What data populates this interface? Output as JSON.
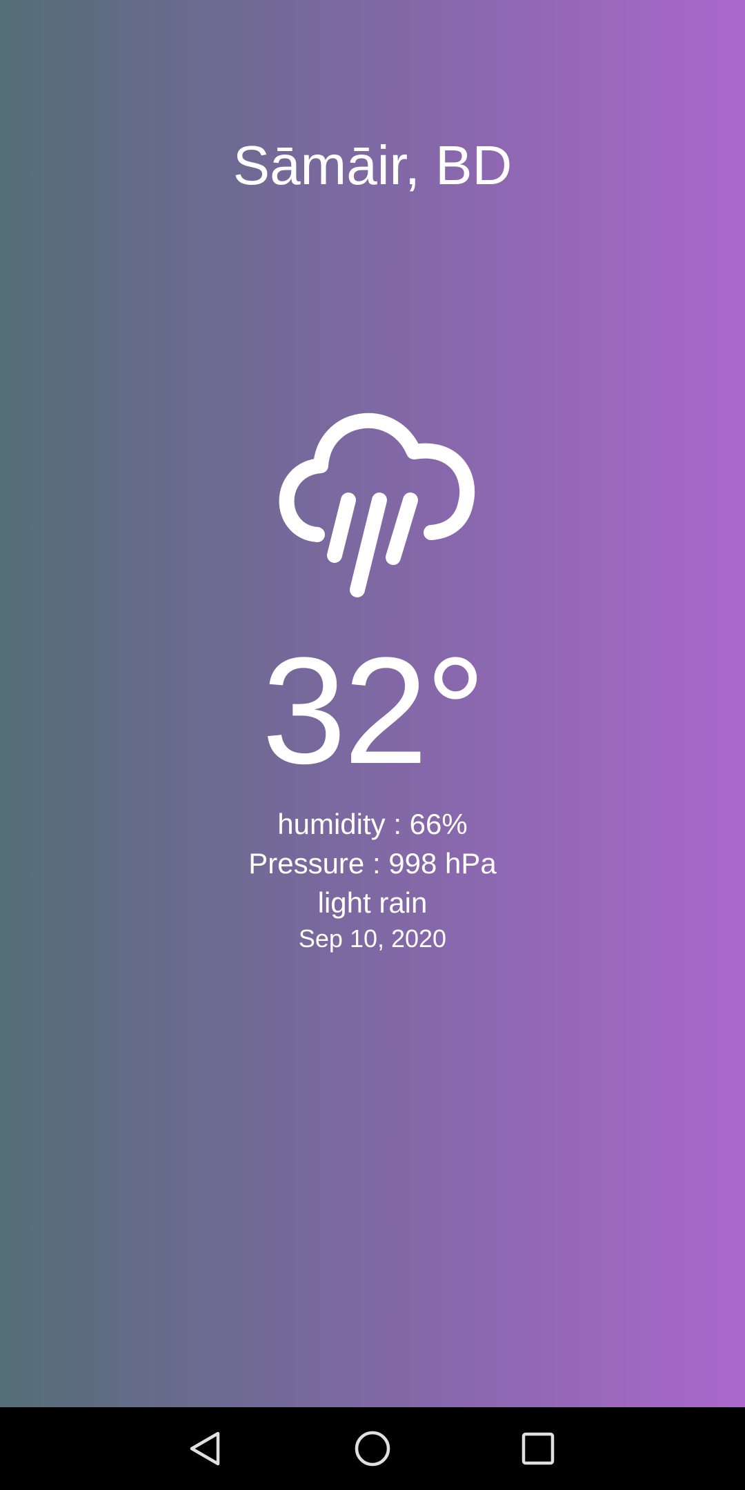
{
  "location": {
    "city": "Sāmāir, BD"
  },
  "weather": {
    "icon": "rain-cloud-icon",
    "temperature": "32°",
    "humidity": "humidity : 66%",
    "pressure": "Pressure : 998 hPa",
    "description": "light rain",
    "date": "Sep 10, 2020"
  },
  "theme": {
    "gradient_start": "#546e76",
    "gradient_end": "#aa68cc",
    "text_color": "#ffffff",
    "navbar_color": "#000000"
  },
  "navbar": {
    "back_icon": "back-triangle-icon",
    "home_icon": "home-circle-icon",
    "recents_icon": "recents-square-icon"
  }
}
